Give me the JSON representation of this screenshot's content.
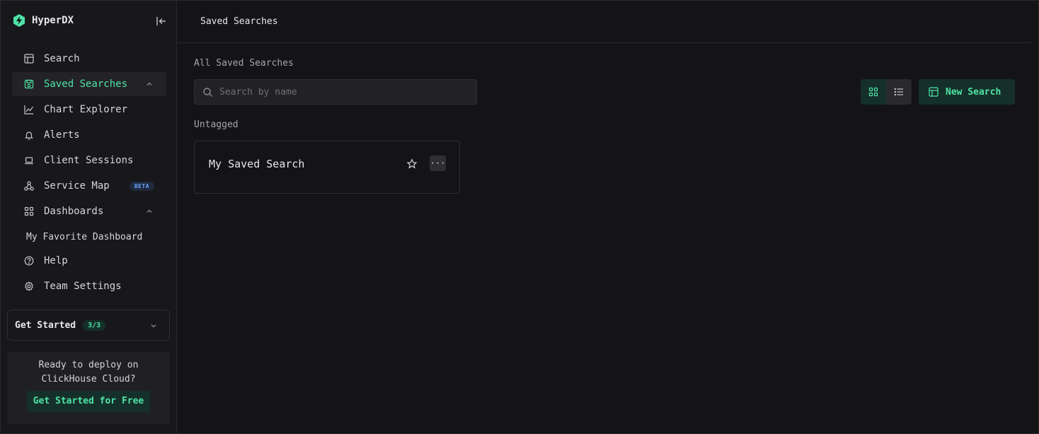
{
  "brand": {
    "name": "HyperDX",
    "accent": "#4fe3a6"
  },
  "sidebar": {
    "items": [
      {
        "label": "Search",
        "icon": "table-icon"
      },
      {
        "label": "Saved Searches",
        "icon": "saved-search-icon"
      },
      {
        "label": "Chart Explorer",
        "icon": "chart-icon"
      },
      {
        "label": "Alerts",
        "icon": "bell-icon"
      },
      {
        "label": "Client Sessions",
        "icon": "laptop-icon"
      },
      {
        "label": "Service Map",
        "icon": "service-map-icon",
        "badge": "BETA"
      },
      {
        "label": "Dashboards",
        "icon": "dashboard-grid-icon"
      },
      {
        "label": "Help",
        "icon": "help-circle-icon"
      },
      {
        "label": "Team Settings",
        "icon": "gear-icon"
      }
    ],
    "dashboards_sub": [
      "My Favorite Dashboard"
    ],
    "get_started": {
      "label": "Get Started",
      "badge": "3/3"
    },
    "promo": {
      "text": "Ready to deploy on ClickHouse Cloud?",
      "button": "Get Started for Free"
    }
  },
  "header": {
    "title": "Saved Searches"
  },
  "main": {
    "section_title": "All Saved Searches",
    "search": {
      "placeholder": "Search by name",
      "value": ""
    },
    "new_search_label": "New Search",
    "groups": [
      {
        "label": "Untagged",
        "cards": [
          {
            "title": "My Saved Search",
            "menu": "···"
          }
        ]
      }
    ]
  }
}
